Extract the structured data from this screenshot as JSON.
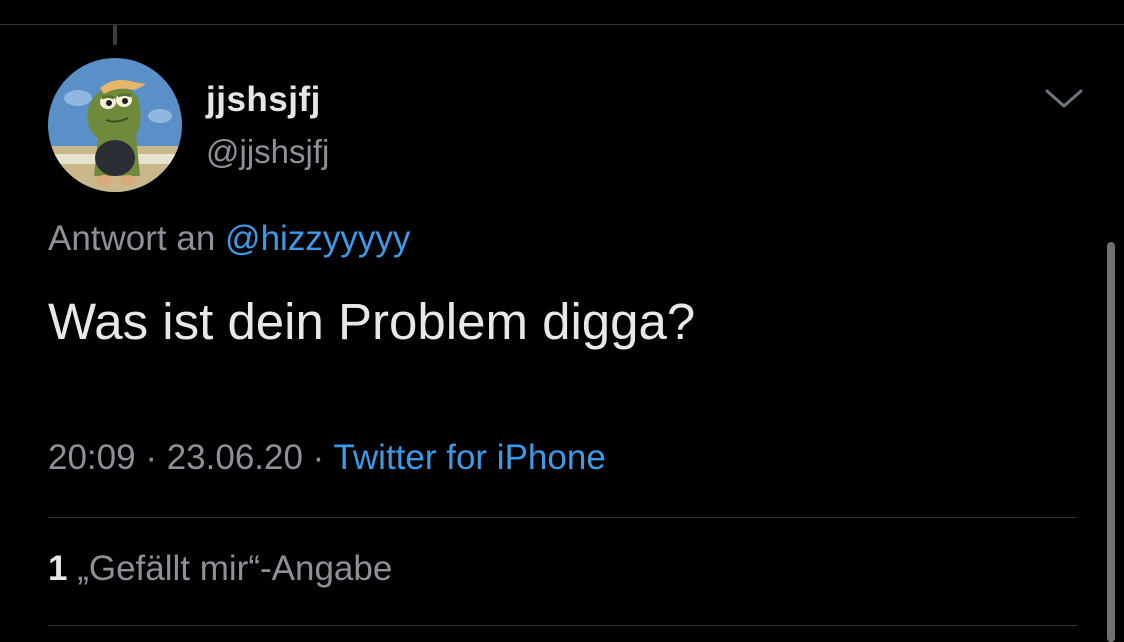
{
  "tweet": {
    "author": {
      "display_name": "jjshsjfj",
      "handle": "@jjshsjfj",
      "avatar": "cartoon-fish-avatar"
    },
    "reply_prefix": "Antwort an",
    "reply_to": "@hizzyyyyy",
    "text": "Was ist dein Problem digga?",
    "time": "20:09",
    "separator": " · ",
    "date": "23.06.20",
    "source": "Twitter for iPhone",
    "likes_count": "1",
    "likes_label": "„Gefällt mir“-Angabe"
  },
  "icons": {
    "menu": "chevron-down-icon"
  },
  "colors": {
    "background": "#000000",
    "primary_text": "#e8e8e8",
    "secondary_text": "#8b9196",
    "link": "#3b9be8",
    "divider": "#2f3336"
  }
}
